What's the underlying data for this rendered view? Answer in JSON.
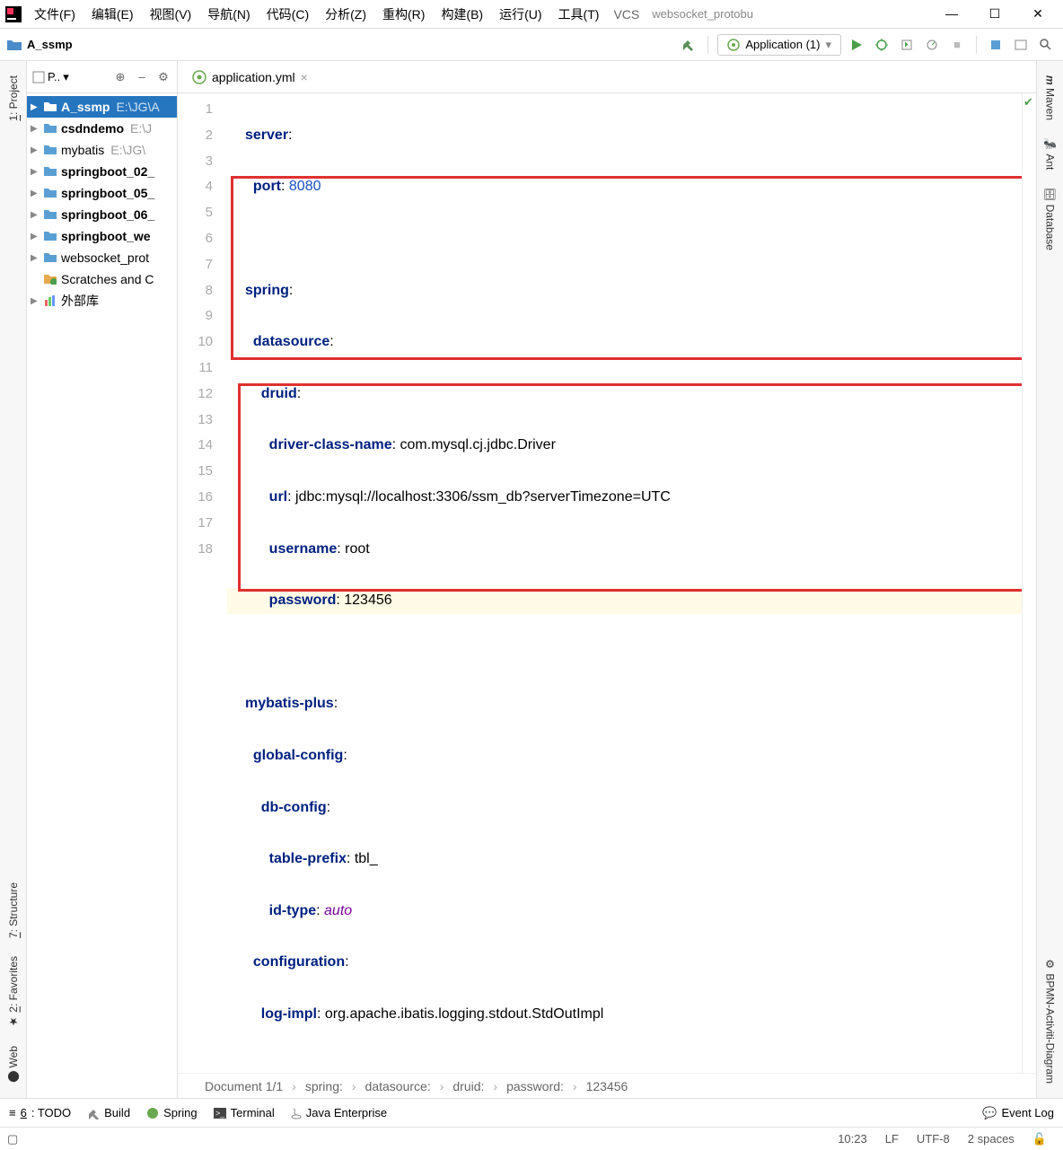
{
  "menu": {
    "file": "文件(F)",
    "edit": "编辑(E)",
    "view": "视图(V)",
    "nav": "导航(N)",
    "code": "代码(C)",
    "analyze": "分析(Z)",
    "refactor": "重构(R)",
    "build": "构建(B)",
    "run": "运行(U)",
    "tools": "工具(T)",
    "vcs": "VCS",
    "window_title": "websocket_protobu"
  },
  "toolbar": {
    "project_name": "A_ssmp",
    "run_config": "Application (1)"
  },
  "project_tree": {
    "header": "P..",
    "items": [
      {
        "name": "A_ssmp",
        "path": "E:\\JG\\A",
        "bold": true,
        "selected": true
      },
      {
        "name": "csdndemo",
        "path": "E:\\J",
        "bold": true
      },
      {
        "name": "mybatis",
        "path": "E:\\JG\\",
        "bold": false
      },
      {
        "name": "springboot_02_",
        "path": "",
        "bold": true
      },
      {
        "name": "springboot_05_",
        "path": "",
        "bold": true
      },
      {
        "name": "springboot_06_",
        "path": "",
        "bold": true
      },
      {
        "name": "springboot_we",
        "path": "",
        "bold": true
      },
      {
        "name": "websocket_prot",
        "path": "",
        "bold": false
      }
    ],
    "scratches": "Scratches and C",
    "external": "外部库"
  },
  "editor": {
    "tab_name": "application.yml",
    "lines": [
      1,
      2,
      3,
      4,
      5,
      6,
      7,
      8,
      9,
      10,
      11,
      12,
      13,
      14,
      15,
      16,
      17,
      18
    ],
    "yaml": {
      "server": "server",
      "port_key": "port",
      "port_val": "8080",
      "spring": "spring",
      "datasource": "datasource",
      "druid": "druid",
      "driver_key": "driver-class-name",
      "driver_val": "com.mysql.cj.jdbc.Driver",
      "url_key": "url",
      "url_val": "jdbc:mysql://localhost:3306/ssm_db?serverTimezone=UTC",
      "username_key": "username",
      "username_val": "root",
      "password_key": "password",
      "password_val": "123456",
      "mybatis": "mybatis-plus",
      "global": "global-config",
      "db": "db-config",
      "prefix_key": "table-prefix",
      "prefix_val": "tbl_",
      "idtype_key": "id-type",
      "idtype_val": "auto",
      "config": "configuration",
      "logimpl_key": "log-impl",
      "logimpl_val": "org.apache.ibatis.logging.stdout.StdOutImpl"
    },
    "breadcrumb": [
      "Document 1/1",
      "spring:",
      "datasource:",
      "druid:",
      "password:",
      "123456"
    ]
  },
  "left_tabs": {
    "project": "1: Project",
    "structure": "7: Structure",
    "favorites": "2: Favorites",
    "web": "Web"
  },
  "right_tabs": {
    "maven": "Maven",
    "ant": "Ant",
    "database": "Database",
    "bpmn": "BPMN-Activiti-Diagram"
  },
  "bottom": {
    "todo": "6: TODO",
    "build": "Build",
    "spring": "Spring",
    "terminal": "Terminal",
    "javaee": "Java Enterprise",
    "event_log": "Event Log"
  },
  "status": {
    "pos": "10:23",
    "lf": "LF",
    "enc": "UTF-8",
    "indent": "2 spaces"
  }
}
